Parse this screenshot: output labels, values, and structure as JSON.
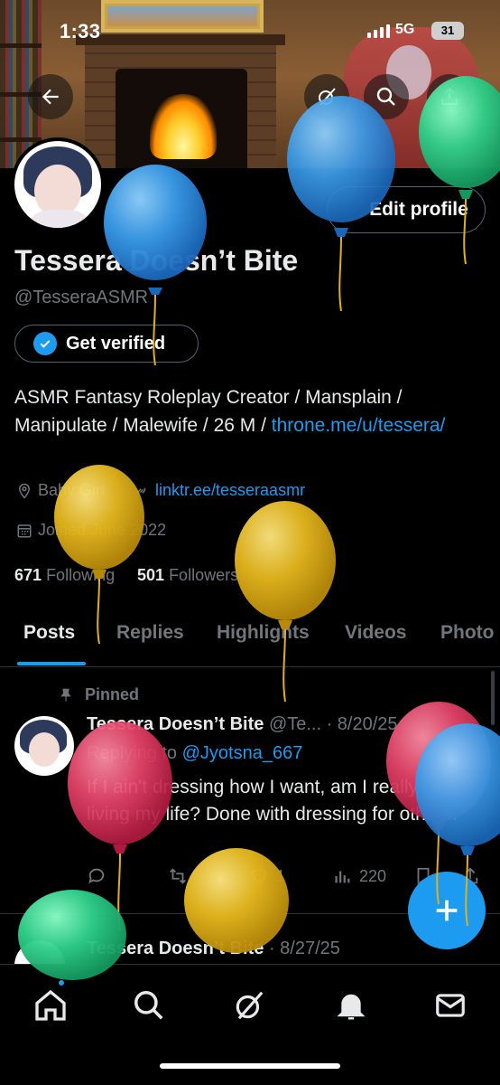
{
  "status_bar": {
    "time": "1:33",
    "network": "5G",
    "battery": "31"
  },
  "banner": {
    "description_icons": [
      "back-arrow-icon",
      "grok-icon",
      "search-icon",
      "share-icon"
    ]
  },
  "profile": {
    "display_name": "Tessera Doesn’t Bite",
    "handle": "@TesseraASMR",
    "edit_label": "Edit profile",
    "verify_label": "Get verified",
    "bio_text": "ASMR Fantasy Roleplay Creator / Mansplain / Manipulate / Malewife / 26 M / ",
    "bio_link": "throne.me/u/tessera/",
    "location": "Baby Girl",
    "website": "linktr.ee/tesseraasmr",
    "joined": "Joined June 2022",
    "following_count": "671",
    "following_label": "Following",
    "followers_count": "501",
    "followers_label": "Followers"
  },
  "tabs": [
    {
      "label": "Posts",
      "active": true
    },
    {
      "label": "Replies"
    },
    {
      "label": "Highlights"
    },
    {
      "label": "Videos"
    },
    {
      "label": "Photo"
    }
  ],
  "pinned_post": {
    "pinned_label": "Pinned",
    "author": "Tessera Doesn’t Bite",
    "handle_date": "@Te... · 8/20/25",
    "reply_prefix": "Replying to ",
    "reply_to": "@Jyotsna_667",
    "text": "If I ain't dressing how I want, am I really living my life? Done with dressing for others.",
    "likes": "1",
    "views": "220"
  },
  "second_post": {
    "author": "Tessera Doesn’t Bite",
    "date": "· 8/27/25"
  },
  "colors": {
    "accent": "#1d9bf0",
    "balloon_blue": "#3a9be8",
    "balloon_yellow": "#e6b81e",
    "balloon_green": "#2fd08a",
    "balloon_red": "#e8456a"
  },
  "bottom_nav": [
    "home-icon",
    "search-icon",
    "grok-icon",
    "notifications-icon",
    "messages-icon"
  ]
}
